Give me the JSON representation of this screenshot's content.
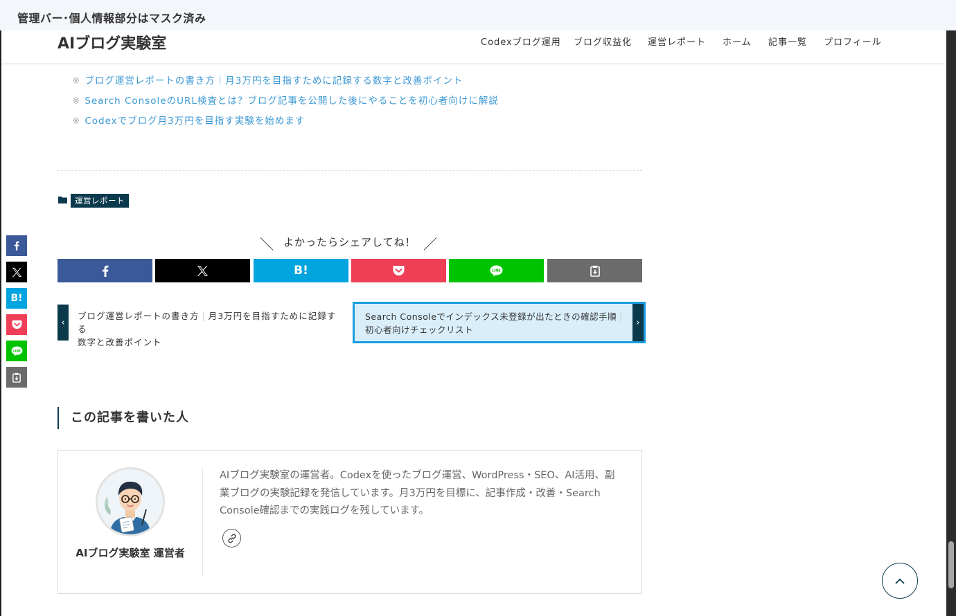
{
  "banner": {
    "text": "管理バー･個人情報部分はマスク済み"
  },
  "header": {
    "logo": "AIブログ実験室",
    "nav": [
      "Codexブログ運用",
      "ブログ収益化",
      "運営レポート",
      "ホーム",
      "記事一覧",
      "プロフィール"
    ]
  },
  "related_links": {
    "mark": "※",
    "items": [
      "ブログ運営レポートの書き方｜月3万円を目指すために記録する数字と改善ポイント",
      "Search ConsoleのURL検査とは？ブログ記事を公開した後にやることを初心者向けに解説",
      "Codexでブログ月3万円を目指す実験を始めます"
    ]
  },
  "category": {
    "label": "運営レポート"
  },
  "share": {
    "title": "よかったらシェアしてね！",
    "left_slash": "＼",
    "right_slash": "／",
    "buttons": [
      {
        "name": "facebook",
        "icon": "facebook-icon",
        "color": "#3b5998"
      },
      {
        "name": "x",
        "icon": "x-icon",
        "color": "#000000"
      },
      {
        "name": "hatena",
        "icon": "hatena-bookmark-icon",
        "label": "B!",
        "color": "#00a4de"
      },
      {
        "name": "pocket",
        "icon": "pocket-icon",
        "color": "#ef3f56"
      },
      {
        "name": "line",
        "icon": "line-icon",
        "color": "#00c300"
      },
      {
        "name": "copy",
        "icon": "clipboard-icon",
        "color": "#6b6b6b"
      }
    ]
  },
  "post_nav": {
    "prev": {
      "title": "ブログ運営レポートの書き方",
      "sub": "月3万円を目指すために記録する",
      "sub2": "数字と改善ポイント",
      "arrow": "‹"
    },
    "next": {
      "title": "Search Consoleでインデックス未登録が出たときの確認手順",
      "sub": "初心者向けチェックリスト",
      "arrow": "›"
    }
  },
  "author": {
    "heading": "この記事を書いた人",
    "name": "AIブログ実験室 運営者",
    "description": "AIブログ実験室の運営者。Codexを使ったブログ運営、WordPress・SEO、AI活用、副業ブログの実験記録を発信しています。月3万円を目標に、記事作成・改善・Search Console確認までの実践ログを残しています。"
  },
  "colors": {
    "accent": "#0b3a4d",
    "link": "#3b98d4",
    "next_border": "#1a9de0",
    "next_bg": "#d9eef9"
  }
}
